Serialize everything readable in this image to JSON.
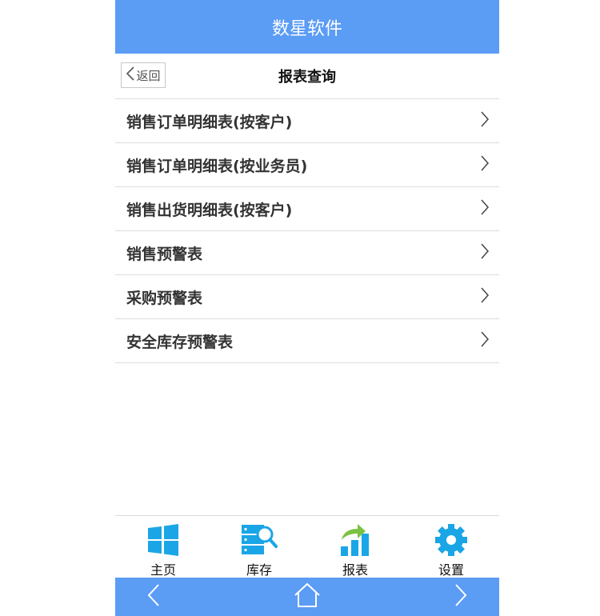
{
  "header": {
    "title": "数星软件"
  },
  "subbar": {
    "back_label": "返回",
    "title": "报表查询"
  },
  "menu": {
    "items": [
      {
        "label": "销售订单明细表(按客户)"
      },
      {
        "label": "销售订单明细表(按业务员)"
      },
      {
        "label": "销售出货明细表(按客户)"
      },
      {
        "label": "销售预警表"
      },
      {
        "label": "采购预警表"
      },
      {
        "label": "安全库存预警表"
      }
    ]
  },
  "tabbar": {
    "tabs": [
      {
        "label": "主页",
        "icon": "windows-home-icon"
      },
      {
        "label": "库存",
        "icon": "inventory-search-icon"
      },
      {
        "label": "报表",
        "icon": "report-chart-icon"
      },
      {
        "label": "设置",
        "icon": "gear-icon"
      }
    ]
  },
  "navbar": {
    "icons": [
      "chevron-left-icon",
      "home-icon",
      "chevron-right-icon"
    ]
  },
  "colors": {
    "accent": "#5b9cf5",
    "icon_blue": "#1aa5e6",
    "report_green": "#7cc242"
  }
}
